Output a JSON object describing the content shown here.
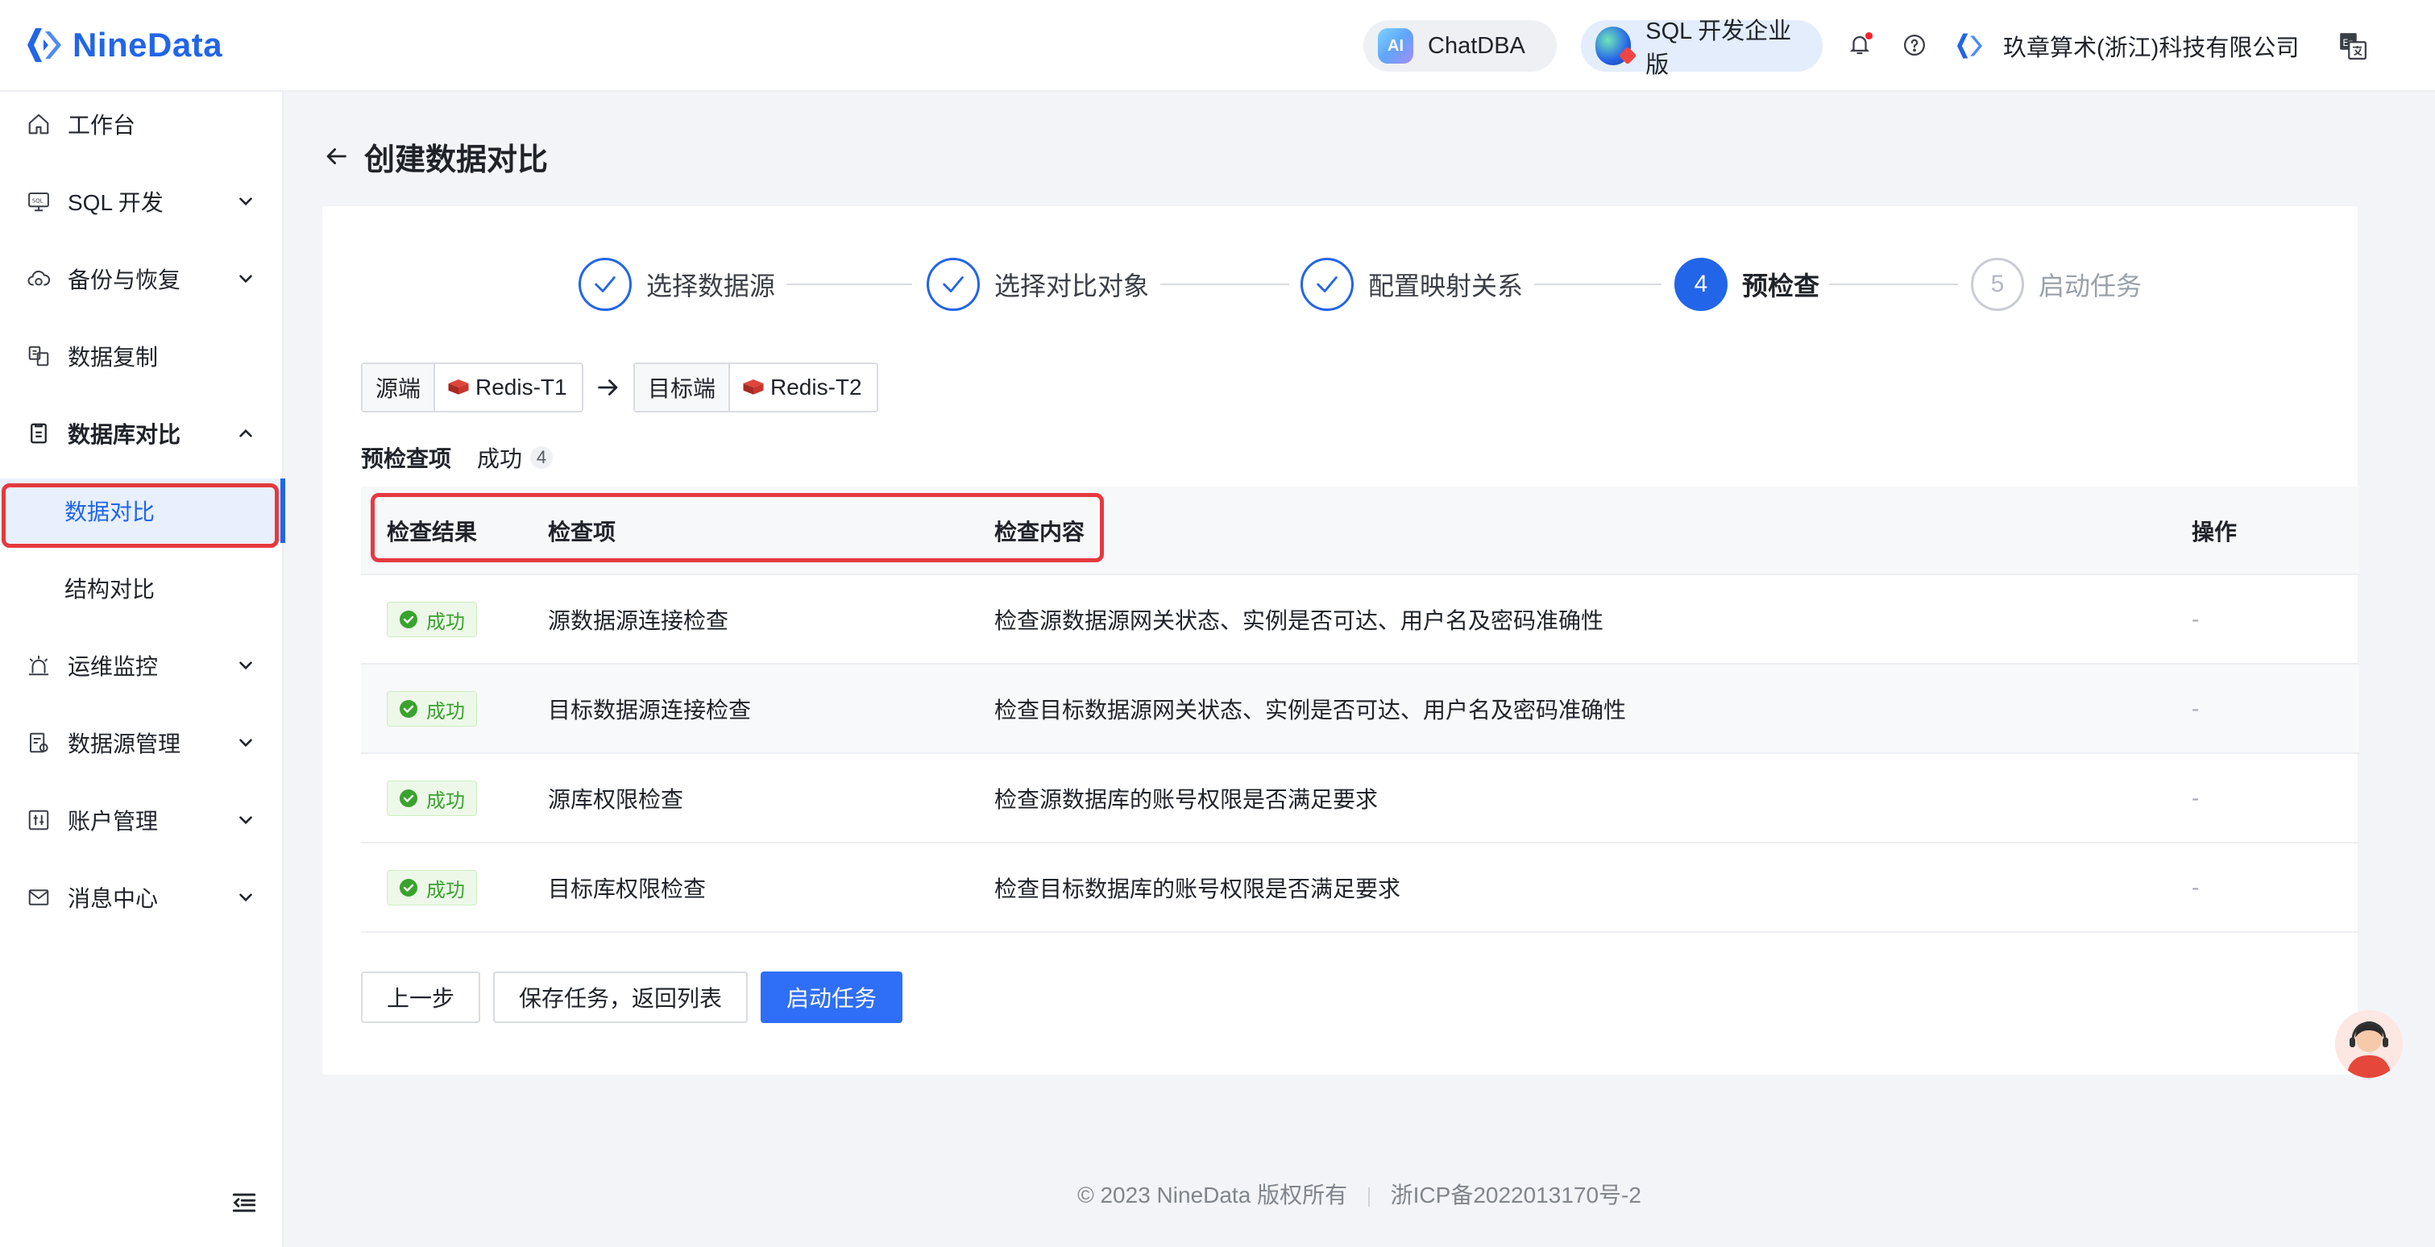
{
  "brand": {
    "name": "NineData",
    "color": "#2265e8"
  },
  "topbar": {
    "chatdba_badge": "AI",
    "chatdba_label": "ChatDBA",
    "sql_label": "SQL 开发企业版",
    "company": "玖章算术(浙江)科技有限公司",
    "icons": [
      "bell-icon",
      "help-icon",
      "language-icon"
    ]
  },
  "sidebar": {
    "items": [
      {
        "label": "工作台",
        "icon": "home-icon"
      },
      {
        "label": "SQL 开发",
        "icon": "sql-icon"
      },
      {
        "label": "备份与恢复",
        "icon": "cloud-backup-icon"
      },
      {
        "label": "数据复制",
        "icon": "copy-icon"
      },
      {
        "label": "数据库对比",
        "icon": "compare-icon"
      },
      {
        "label": "数据对比"
      },
      {
        "label": "结构对比"
      },
      {
        "label": "运维监控",
        "icon": "alarm-icon"
      },
      {
        "label": "数据源管理",
        "icon": "datasource-icon"
      },
      {
        "label": "账户管理",
        "icon": "account-icon"
      },
      {
        "label": "消息中心",
        "icon": "mail-icon"
      }
    ]
  },
  "page": {
    "title": "创建数据对比"
  },
  "steps": [
    {
      "number": "1",
      "label": "选择数据源",
      "status": "done"
    },
    {
      "number": "2",
      "label": "选择对比对象",
      "status": "done"
    },
    {
      "number": "3",
      "label": "配置映射关系",
      "status": "done"
    },
    {
      "number": "4",
      "label": "预检查",
      "status": "current"
    },
    {
      "number": "5",
      "label": "启动任务",
      "status": "pending"
    }
  ],
  "endpoints": {
    "source_tag": "源端",
    "source_value": "Redis-T1",
    "target_tag": "目标端",
    "target_value": "Redis-T2"
  },
  "tabs": {
    "main": "预检查项",
    "success_label": "成功",
    "success_count": "4"
  },
  "table": {
    "columns": [
      "检查结果",
      "检查项",
      "检查内容",
      "操作"
    ],
    "rows": [
      {
        "result": "成功",
        "item": "源数据源连接检查",
        "content": "检查源数据源网关状态、实例是否可达、用户名及密码准确性",
        "action": "-"
      },
      {
        "result": "成功",
        "item": "目标数据源连接检查",
        "content": "检查目标数据源网关状态、实例是否可达、用户名及密码准确性",
        "action": "-"
      },
      {
        "result": "成功",
        "item": "源库权限检查",
        "content": "检查源数据库的账号权限是否满足要求",
        "action": "-"
      },
      {
        "result": "成功",
        "item": "目标库权限检查",
        "content": "检查目标数据库的账号权限是否满足要求",
        "action": "-"
      }
    ]
  },
  "buttons": {
    "prev": "上一步",
    "save": "保存任务，返回列表",
    "start": "启动任务"
  },
  "footer": {
    "copyright": "2023 NineData 版权所有",
    "icp": "浙ICP备2022013170号-2"
  },
  "colors": {
    "primary": "#2265e8",
    "success": "#3aa22e",
    "highlight": "#e5393f"
  }
}
